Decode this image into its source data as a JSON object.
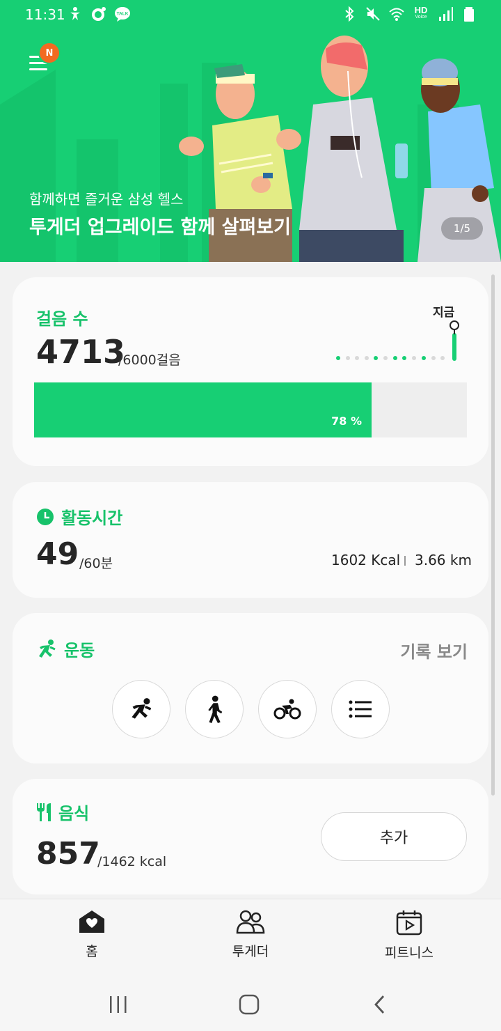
{
  "status_bar": {
    "time": "11:31",
    "left_icons": [
      "accessibility-icon",
      "ring-icon",
      "talk-icon"
    ],
    "talk_badge": "TALK",
    "hd_label": "HD",
    "hd_sub": "Voice",
    "right_icons": [
      "bluetooth-icon",
      "mute-icon",
      "wifi-icon",
      "hd-voice-icon",
      "signal-icon",
      "battery-icon"
    ]
  },
  "hero": {
    "menu_badge": "N",
    "subtitle": "함께하면 즐거운 삼성 헬스",
    "title": "투게더 업그레이드 함께 살펴보기",
    "pager": "1/5"
  },
  "steps": {
    "title": "걸음 수",
    "value": "4713",
    "goal": "/6000걸음",
    "now_label": "지금",
    "progress_percent": 78,
    "progress_label": "78 %"
  },
  "activity": {
    "title": "활동시간",
    "value": "49",
    "goal": "/60분",
    "kcal": "1602 Kcal",
    "distance": "3.66 km"
  },
  "exercise": {
    "title": "운동",
    "history_link": "기록 보기",
    "buttons": [
      "running-icon",
      "walking-icon",
      "cycling-icon",
      "list-icon"
    ]
  },
  "food": {
    "title": "음식",
    "value": "857",
    "goal": "/1462 kcal",
    "add_label": "추가"
  },
  "bottom_nav": {
    "home": "홈",
    "together": "투게더",
    "fitness": "피트니스"
  },
  "colors": {
    "brand_green": "#17cf74",
    "title_green": "#17c26a",
    "badge_orange": "#f26a21"
  }
}
